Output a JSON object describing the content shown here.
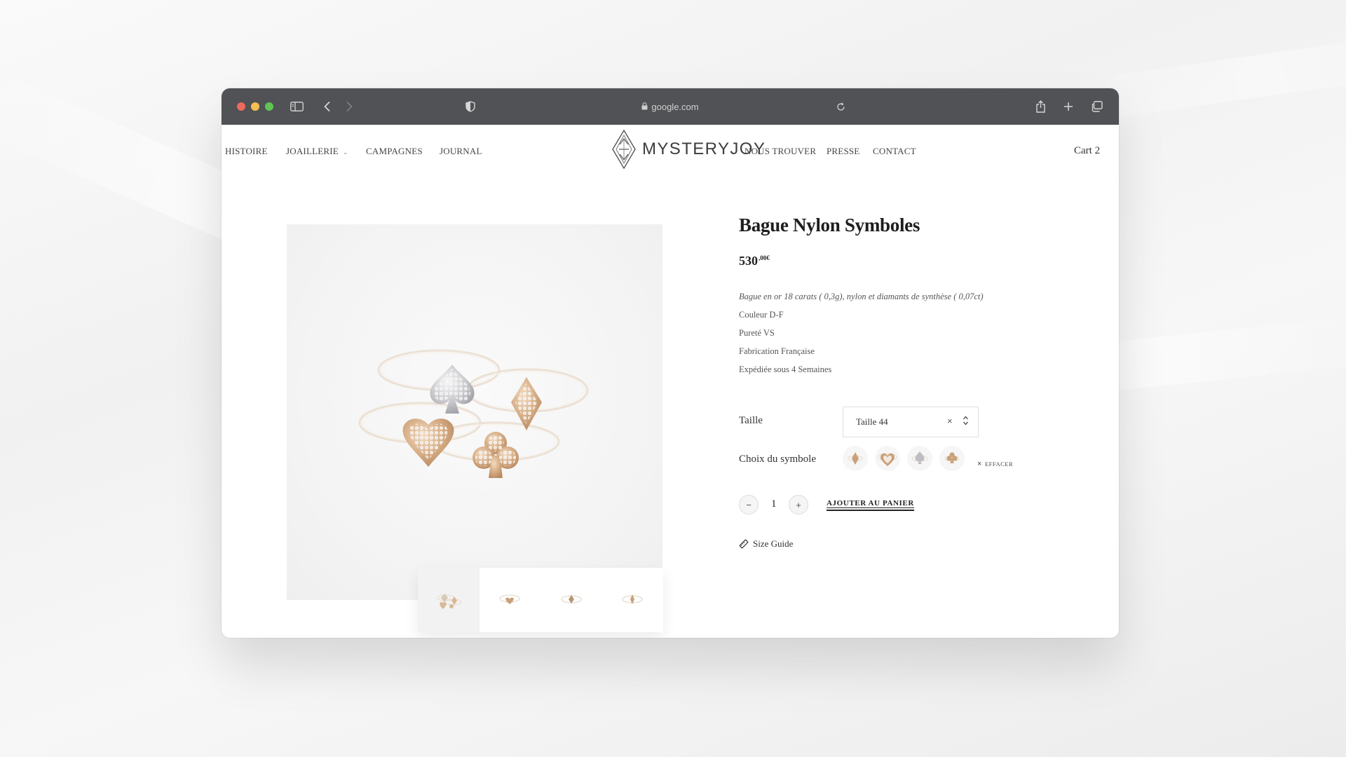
{
  "browser": {
    "url": "google.com",
    "traffic_lights": [
      "#ed6a5e",
      "#f5bf4f",
      "#61c554"
    ]
  },
  "nav": {
    "left": [
      "HISTOIRE",
      "JOAILLERIE",
      "CAMPAGNES",
      "JOURNAL"
    ],
    "right": [
      "NOUS TROUVER",
      "PRESSE",
      "CONTACT"
    ],
    "cart": "Cart 2",
    "brand": "MYSTERYJOY"
  },
  "product": {
    "title": "Bague Nylon Symboles",
    "price_main": "530",
    "price_cents": ",00€",
    "description": [
      "Bague en or 18 carats ( 0,3g), nylon et diamants de synthèse ( 0,07ct)",
      "Couleur D-F",
      "Pureté VS",
      "Fabrication Française",
      "Expédiée sous 4 Semaines"
    ],
    "size_label": "Taille",
    "size_value": "Taille 44",
    "symbol_label": "Choix du symbole",
    "symbols": [
      "carreau",
      "coeur",
      "pique",
      "trefle"
    ],
    "clear_label": "EFFACER",
    "quantity": "1",
    "minus": "−",
    "plus": "+",
    "add_to_cart": "AJOUTER AU PANIER",
    "size_guide": "Size Guide",
    "gold_color": "#c9a07a",
    "white_gold_color": "#b9b9bd",
    "dark_label_color": "#1e1e1e"
  }
}
